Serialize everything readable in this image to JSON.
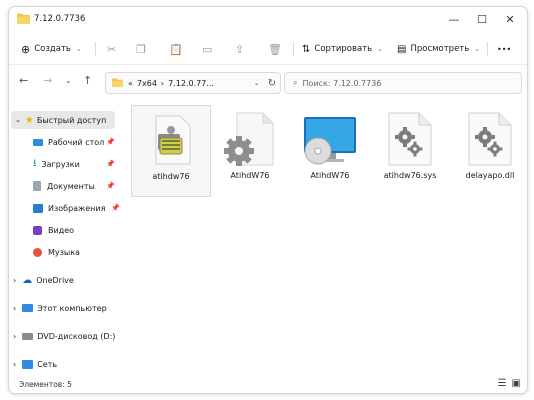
{
  "window": {
    "title": "7.12.0.7736"
  },
  "toolbar": {
    "create_label": "Создать",
    "sort_label": "Сортировать",
    "view_label": "Просмотреть",
    "more_label": "•••"
  },
  "address": {
    "overflow": "«",
    "crumbs": [
      "7x64",
      "7.12.0.77..."
    ],
    "search_placeholder": "Поиск: 7.12.0.7736"
  },
  "nav": {
    "quick_access": "Быстрый доступ",
    "pinned": [
      {
        "label": "Рабочий стол",
        "icon": "desktop-icon"
      },
      {
        "label": "Загрузки",
        "icon": "downloads-icon"
      },
      {
        "label": "Документы",
        "icon": "documents-icon"
      },
      {
        "label": "Изображения",
        "icon": "pictures-icon"
      },
      {
        "label": "Видео",
        "icon": "video-icon"
      },
      {
        "label": "Музыка",
        "icon": "music-icon"
      }
    ],
    "onedrive": "OneDrive",
    "this_pc": "Этот компьютер",
    "dvd": "DVD-дисковод (D:)",
    "network": "Сеть"
  },
  "files": [
    {
      "name": "atihdw76",
      "icon": "setup-info-icon"
    },
    {
      "name": "AtihdW76",
      "icon": "config-gear-icon"
    },
    {
      "name": "AtihdW76",
      "icon": "disc-monitor-icon"
    },
    {
      "name": "atihdw76.sys",
      "icon": "system-file-icon"
    },
    {
      "name": "delayapo.dll",
      "icon": "dll-file-icon"
    }
  ],
  "status": {
    "items": "Элементов: 5"
  },
  "colors": {
    "folder": "#f3c443",
    "accent": "#0067c0",
    "selection": "#e8e8e8"
  }
}
